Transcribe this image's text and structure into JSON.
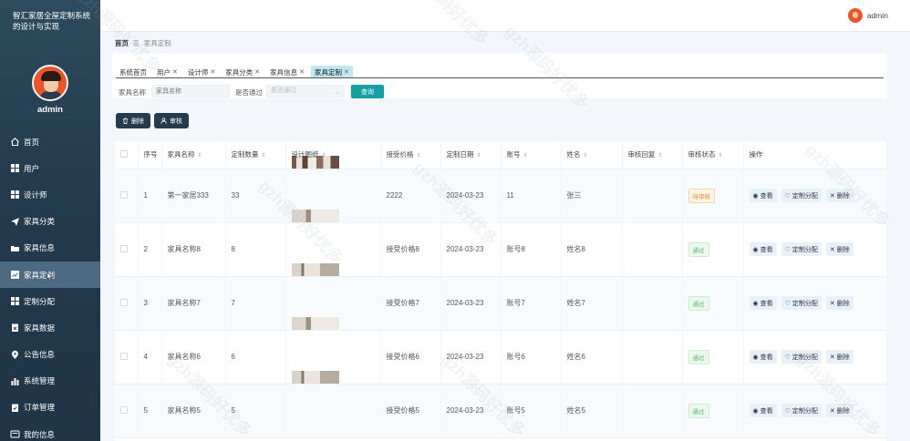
{
  "sidebar": {
    "system_title": "智汇家居全屋定制系统的设计与实现",
    "admin_name": "admin",
    "items": [
      {
        "label": "首页",
        "icon": "home-icon"
      },
      {
        "label": "用户",
        "icon": "grid-icon"
      },
      {
        "label": "设计师",
        "icon": "grid-icon"
      },
      {
        "label": "家具分类",
        "icon": "send-icon"
      },
      {
        "label": "家具信息",
        "icon": "folder-icon"
      },
      {
        "label": "家具定制",
        "icon": "chart-icon"
      },
      {
        "label": "定制分配",
        "icon": "grid-icon"
      },
      {
        "label": "家具数据",
        "icon": "clipboard-icon"
      },
      {
        "label": "公告信息",
        "icon": "location-icon"
      },
      {
        "label": "系统管理",
        "icon": "bar-chart-icon"
      },
      {
        "label": "订单管理",
        "icon": "clipboard-check-icon"
      },
      {
        "label": "我的信息",
        "icon": "id-card-icon"
      }
    ]
  },
  "topbar": {
    "user": "admin"
  },
  "breadcrumb": {
    "home": "首页",
    "separator": "☰",
    "current": "家具定制"
  },
  "tabs": [
    {
      "label": "系统首页",
      "closable": false
    },
    {
      "label": "用户",
      "closable": true
    },
    {
      "label": "设计师",
      "closable": true
    },
    {
      "label": "家具分类",
      "closable": true
    },
    {
      "label": "家具信息",
      "closable": true
    },
    {
      "label": "家具定制",
      "closable": true
    }
  ],
  "search": {
    "name_label": "家具名称",
    "name_placeholder": "家具名称",
    "pass_label": "是否通过",
    "pass_placeholder": "是否通过",
    "query_button": "查询"
  },
  "actions": {
    "delete": "删除",
    "audit": "审核"
  },
  "table": {
    "columns": [
      "序号",
      "家具名称",
      "定制数量",
      "设计图纸",
      "接受价格",
      "定制日期",
      "账号",
      "姓名",
      "审核回复",
      "审核状态",
      "操作"
    ],
    "rows": [
      {
        "index": "1",
        "name": "第一家居333",
        "quantity": "33",
        "price": "2222",
        "date": "2024-03-23",
        "account": "11",
        "person": "张三",
        "reply": "",
        "status": "待审核",
        "status_type": "pending"
      },
      {
        "index": "2",
        "name": "家具名称8",
        "quantity": "8",
        "price": "接受价格8",
        "date": "2024-03-23",
        "account": "账号8",
        "person": "姓名8",
        "reply": "",
        "status": "通过",
        "status_type": "pass"
      },
      {
        "index": "3",
        "name": "家具名称7",
        "quantity": "7",
        "price": "接受价格7",
        "date": "2024-03-23",
        "account": "账号7",
        "person": "姓名7",
        "reply": "",
        "status": "通过",
        "status_type": "pass"
      },
      {
        "index": "4",
        "name": "家具名称6",
        "quantity": "6",
        "price": "接受价格6",
        "date": "2024-03-23",
        "account": "账号6",
        "person": "姓名6",
        "reply": "",
        "status": "通过",
        "status_type": "pass"
      },
      {
        "index": "5",
        "name": "家具名称5",
        "quantity": "5",
        "price": "接受价格5",
        "date": "2024-03-23",
        "account": "账号5",
        "person": "姓名5",
        "reply": "",
        "status": "通过",
        "status_type": "pass"
      }
    ],
    "row_ops": {
      "view": "查看",
      "assign": "定制分配",
      "delete": "删除"
    }
  },
  "watermark": "gzh源码好优多",
  "colors": {
    "sidebar": "#233c4e",
    "active_menu": "#4d6b80",
    "accent": "#14a0a4",
    "active_tab": "#bfe8f3"
  }
}
